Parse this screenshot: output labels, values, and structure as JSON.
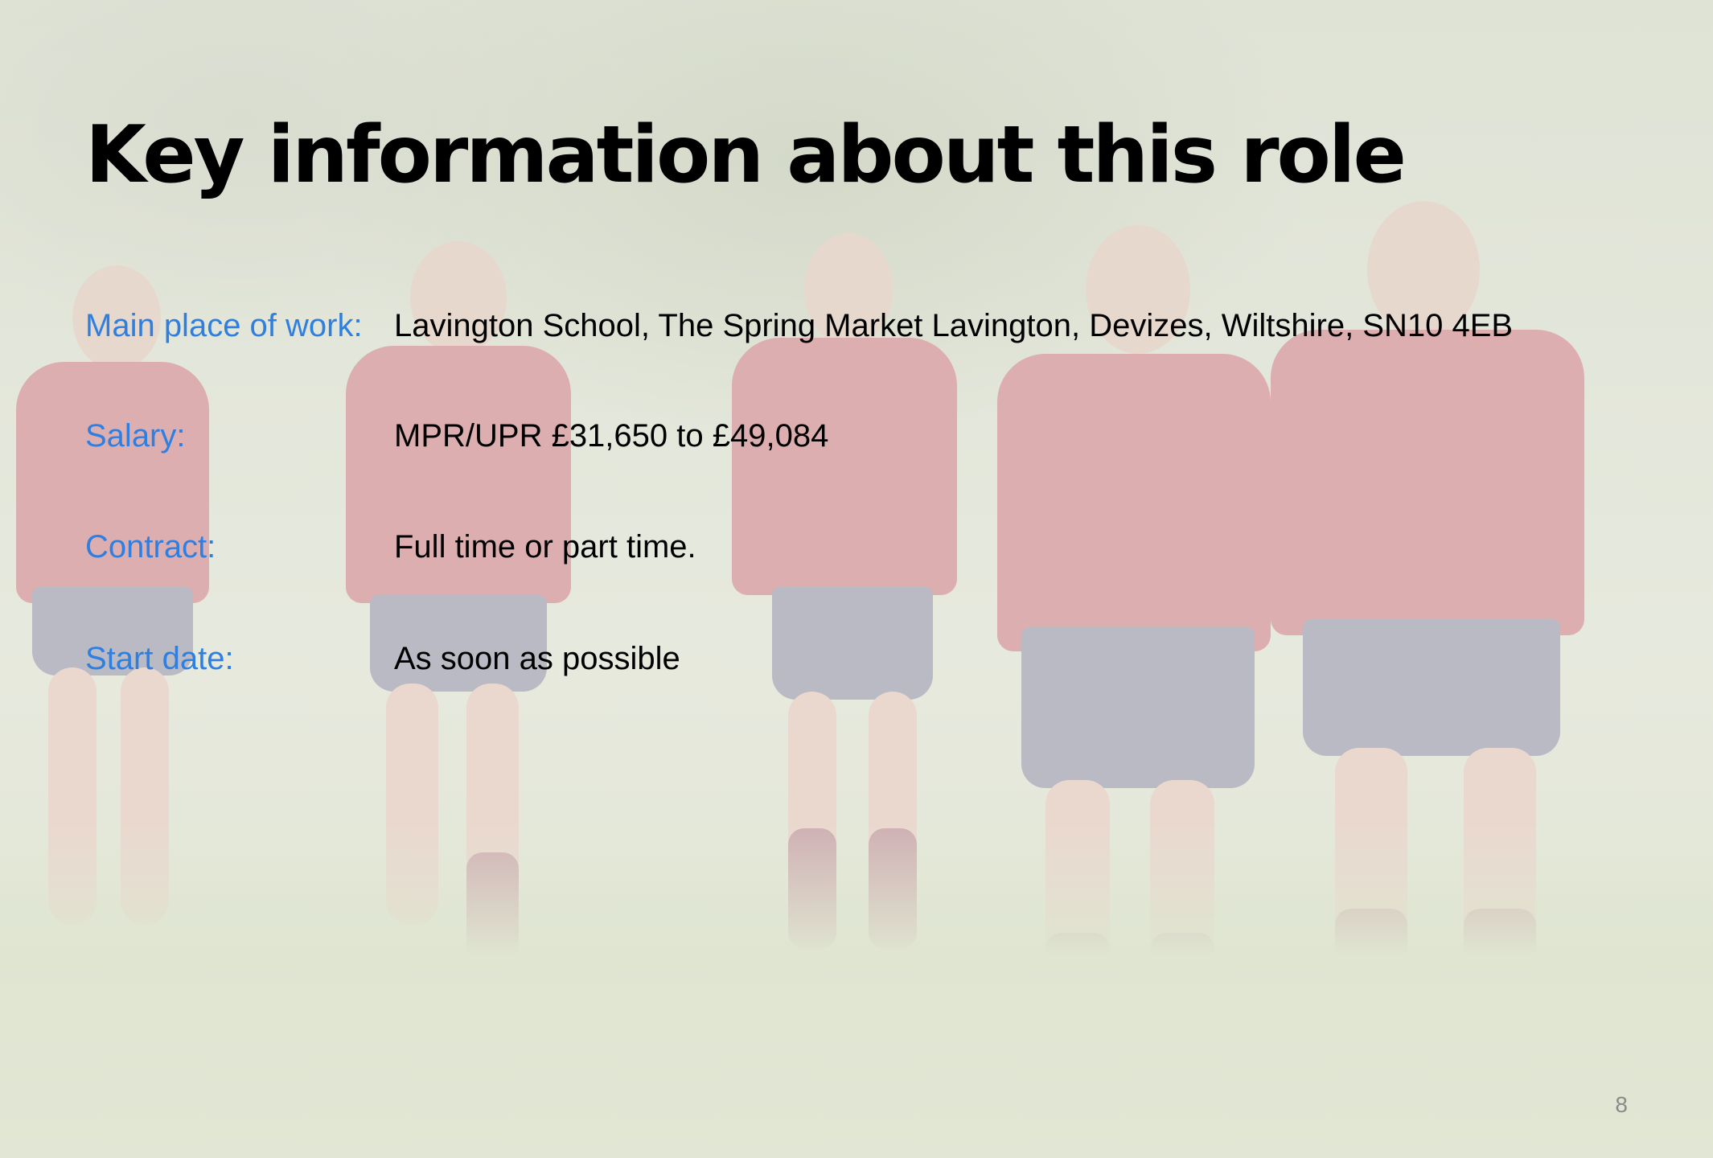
{
  "slide": {
    "title": "Key information about this role",
    "rows": [
      {
        "label": "Main place of work:",
        "value": "Lavington School, The Spring Market Lavington, Devizes, Wiltshire, SN10 4EB"
      },
      {
        "label": "Salary:",
        "value": "MPR/UPR £31,650 to £49,084"
      },
      {
        "label": "Contract:",
        "value": "Full time or part time."
      },
      {
        "label": "Start date:",
        "value": "As soon as possible"
      }
    ],
    "page_number": "8"
  },
  "colors": {
    "label": "#2f7fe0",
    "value": "#000000",
    "title": "#000000"
  },
  "background": {
    "image": "faded photo of students in red sports kit walking on a grass field"
  }
}
